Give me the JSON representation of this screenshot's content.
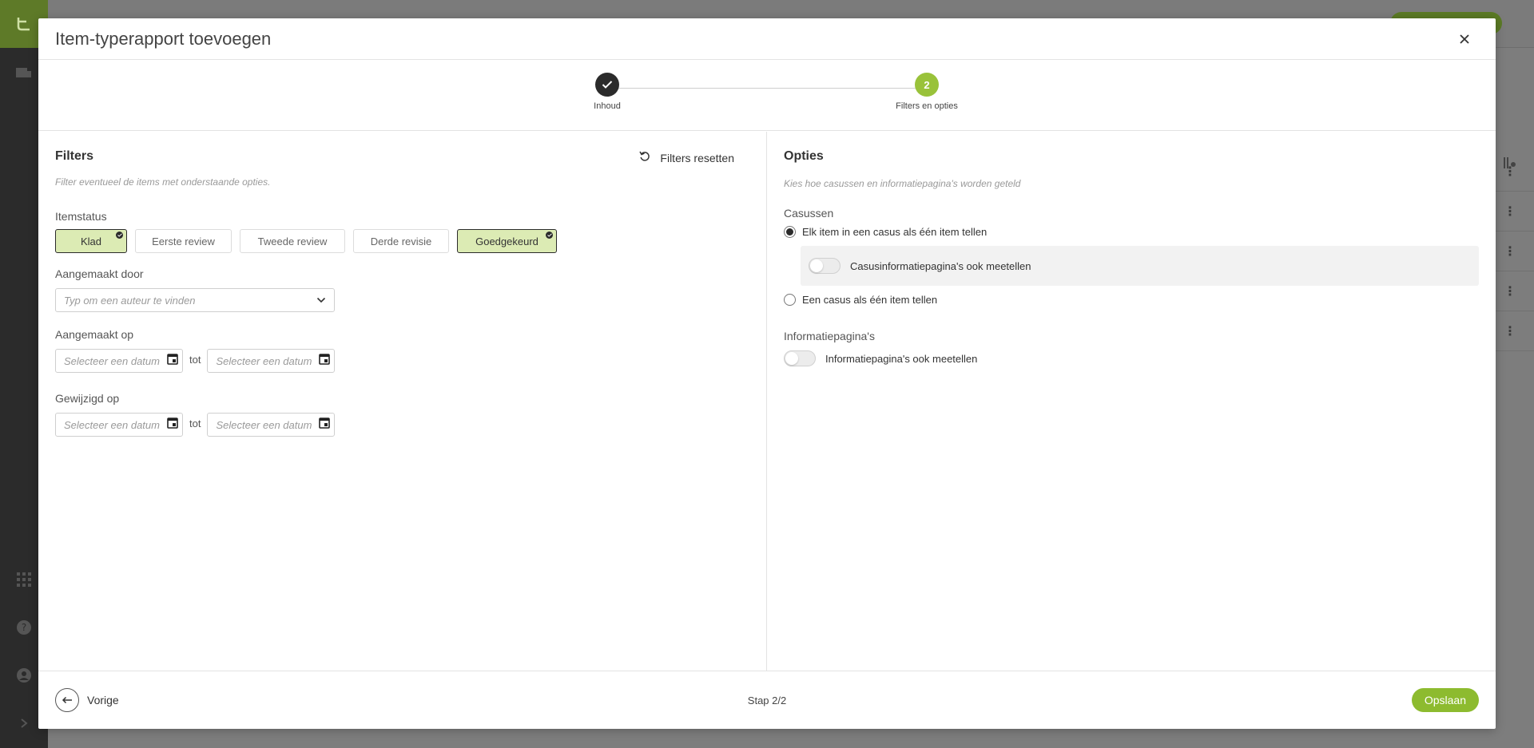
{
  "modal": {
    "title": "Item-typerapport toevoegen",
    "close_icon": "close-icon"
  },
  "stepper": {
    "steps": [
      {
        "label": "Inhoud",
        "state": "completed",
        "icon": "check-icon"
      },
      {
        "label": "Filters en opties",
        "number": "2",
        "state": "active"
      }
    ]
  },
  "filters": {
    "title": "Filters",
    "subtitle": "Filter eventueel de items met onderstaande opties.",
    "reset_label": "Filters resetten",
    "itemstatus_label": "Itemstatus",
    "statuses": [
      {
        "label": "Klad",
        "selected": true
      },
      {
        "label": "Eerste review",
        "selected": false
      },
      {
        "label": "Tweede review",
        "selected": false
      },
      {
        "label": "Derde revisie",
        "selected": false
      },
      {
        "label": "Goedgekeurd",
        "selected": true
      }
    ],
    "created_by_label": "Aangemaakt door",
    "author_placeholder": "Typ om een auteur te vinden",
    "created_on_label": "Aangemaakt op",
    "modified_on_label": "Gewijzigd op",
    "date_placeholder": "Selecteer een datum",
    "to_label": "tot"
  },
  "options": {
    "title": "Opties",
    "subtitle": "Kies hoe casussen en informatiepagina's worden geteld",
    "cases_label": "Casussen",
    "radio_each_item": "Elk item in een casus als één item tellen",
    "toggle_case_info": "Casusinformatiepagina's ook meetellen",
    "radio_case_one": "Een casus als één item tellen",
    "infopages_label": "Informatiepagina's",
    "toggle_infopages": "Informatiepagina's ook meetellen"
  },
  "footer": {
    "back_label": "Vorige",
    "step_count": "Stap 2/2",
    "save_label": "Opslaan"
  },
  "colors": {
    "accent": "#8dbb2f",
    "step_active": "#99c23a",
    "chip_selected": "#dcebb4",
    "dark": "#2b2b2b"
  }
}
